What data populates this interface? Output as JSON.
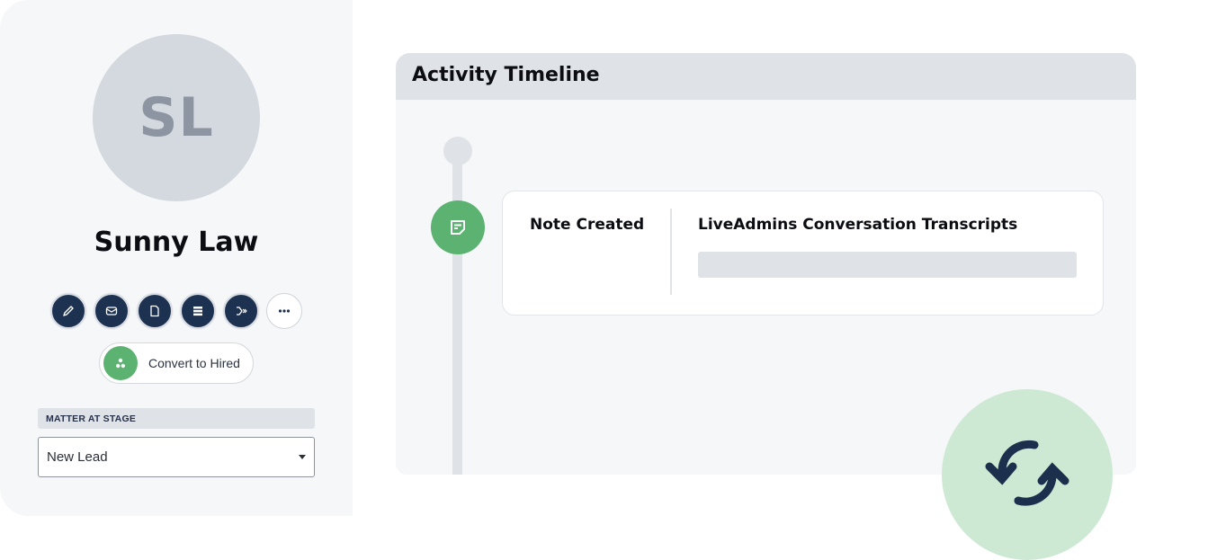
{
  "profile": {
    "initials": "SL",
    "name": "Sunny Law",
    "actions": [
      {
        "icon": "pencil-icon",
        "label": "Edit"
      },
      {
        "icon": "mail-icon",
        "label": "Email"
      },
      {
        "icon": "document-icon",
        "label": "Document"
      },
      {
        "icon": "list-icon",
        "label": "List"
      },
      {
        "icon": "workflow-icon",
        "label": "Workflow"
      },
      {
        "icon": "more-icon",
        "label": "More"
      }
    ],
    "convert_button": {
      "label": "Convert to Hired",
      "icon": "user-group-icon"
    },
    "stage": {
      "label": "MATTER AT STAGE",
      "selected": "New Lead"
    }
  },
  "timeline": {
    "title": "Activity Timeline",
    "events": [
      {
        "icon": "note-icon",
        "type": "Note Created",
        "title": "LiveAdmins Conversation Transcripts"
      }
    ]
  },
  "badge": {
    "icon": "sync-icon"
  },
  "colors": {
    "navy": "#1d3150",
    "green": "#5cb270",
    "light_green": "#cde9d4",
    "panel_bg": "#f5f7f9",
    "header_bg": "#dfe2e7"
  }
}
